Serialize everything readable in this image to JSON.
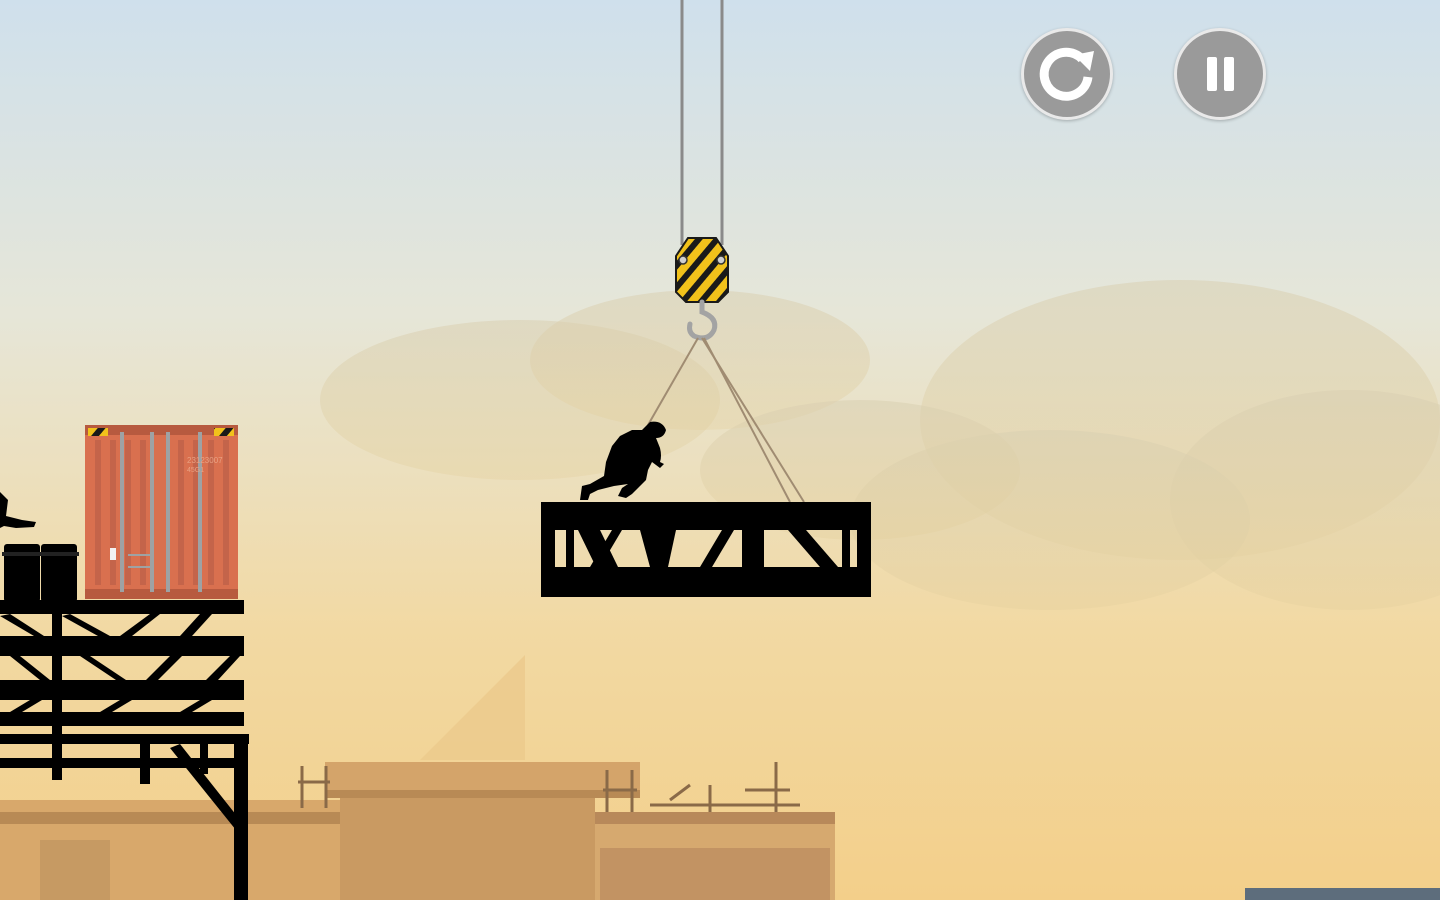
{
  "game": {
    "hud": {
      "restart_button": {
        "icon": "restart-icon"
      },
      "pause_button": {
        "icon": "pause-icon"
      }
    },
    "container": {
      "code_text": "23123007",
      "sub_text": "45G1"
    },
    "colors": {
      "sky_top": "#cfe0ec",
      "sky_bottom": "#f3cf8a",
      "silhouette": "#000000",
      "container_orange": "#d9704f",
      "hazard_yellow": "#f2c21b",
      "button_grey": "#9a9a9a"
    }
  }
}
